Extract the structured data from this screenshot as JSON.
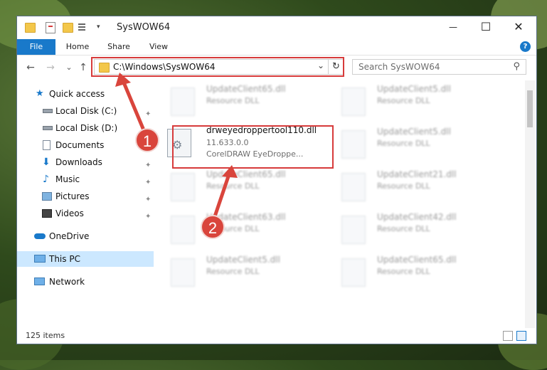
{
  "window": {
    "title": "SysWOW64",
    "minimize_glyph": "—",
    "maximize_glyph": "☐",
    "close_glyph": "✕"
  },
  "ribbon": {
    "tabs": [
      "File",
      "Home",
      "Share",
      "View"
    ],
    "help_glyph": "?"
  },
  "nav": {
    "back_glyph": "←",
    "forward_glyph": "→",
    "recent_glyph": "⌄",
    "up_glyph": "↑",
    "address": "C:\\Windows\\SysWOW64",
    "address_dropdown_glyph": "⌄",
    "refresh_glyph": "↻",
    "search_placeholder": "Search SysWOW64",
    "search_glyph": "⚲"
  },
  "sidebar": {
    "items": [
      {
        "label": "Quick access",
        "icon": "star-icon"
      },
      {
        "label": "Local Disk (C:)",
        "icon": "drive-icon",
        "pinned": true
      },
      {
        "label": "Local Disk (D:)",
        "icon": "drive-icon",
        "pinned": true
      },
      {
        "label": "Documents",
        "icon": "documents-icon",
        "pinned": true
      },
      {
        "label": "Downloads",
        "icon": "downloads-icon",
        "pinned": true
      },
      {
        "label": "Music",
        "icon": "music-icon",
        "pinned": true
      },
      {
        "label": "Pictures",
        "icon": "pictures-icon",
        "pinned": true
      },
      {
        "label": "Videos",
        "icon": "videos-icon",
        "pinned": true
      },
      {
        "label": "OneDrive",
        "icon": "cloud-icon"
      },
      {
        "label": "This PC",
        "icon": "computer-icon",
        "selected": true
      },
      {
        "label": "Network",
        "icon": "network-icon"
      }
    ],
    "pin_glyph": "📌"
  },
  "files": {
    "highlighted": {
      "name": "drweyedroppertool110.dll",
      "version": "11.633.0.0",
      "description": "CorelDRAW EyeDroppe..."
    },
    "background": [
      {
        "name": "UpdateClient65.dll",
        "type": "Resource DLL"
      },
      {
        "name": "UpdateClient5.dll",
        "type": "Resource DLL"
      },
      {
        "name": "UpdateClient5.dll",
        "type": "Resource DLL"
      },
      {
        "name": "UpdateClient65.dll",
        "type": "Resource DLL"
      },
      {
        "name": "UpdateClient21.dll",
        "type": "Resource DLL"
      },
      {
        "name": "UpdateClient63.dll",
        "type": "Resource DLL"
      },
      {
        "name": "UpdateClient42.dll",
        "type": "Resource DLL"
      },
      {
        "name": "UpdateClient5.dll",
        "type": "Resource DLL"
      },
      {
        "name": "UpdateClient65.dll",
        "type": "Resource DLL"
      }
    ]
  },
  "annotations": {
    "step1": "1",
    "step2": "2"
  },
  "status": {
    "item_count": "125 items"
  },
  "colors": {
    "accent": "#1979ca",
    "highlight": "#d73b3b",
    "selected": "#cce8ff"
  }
}
